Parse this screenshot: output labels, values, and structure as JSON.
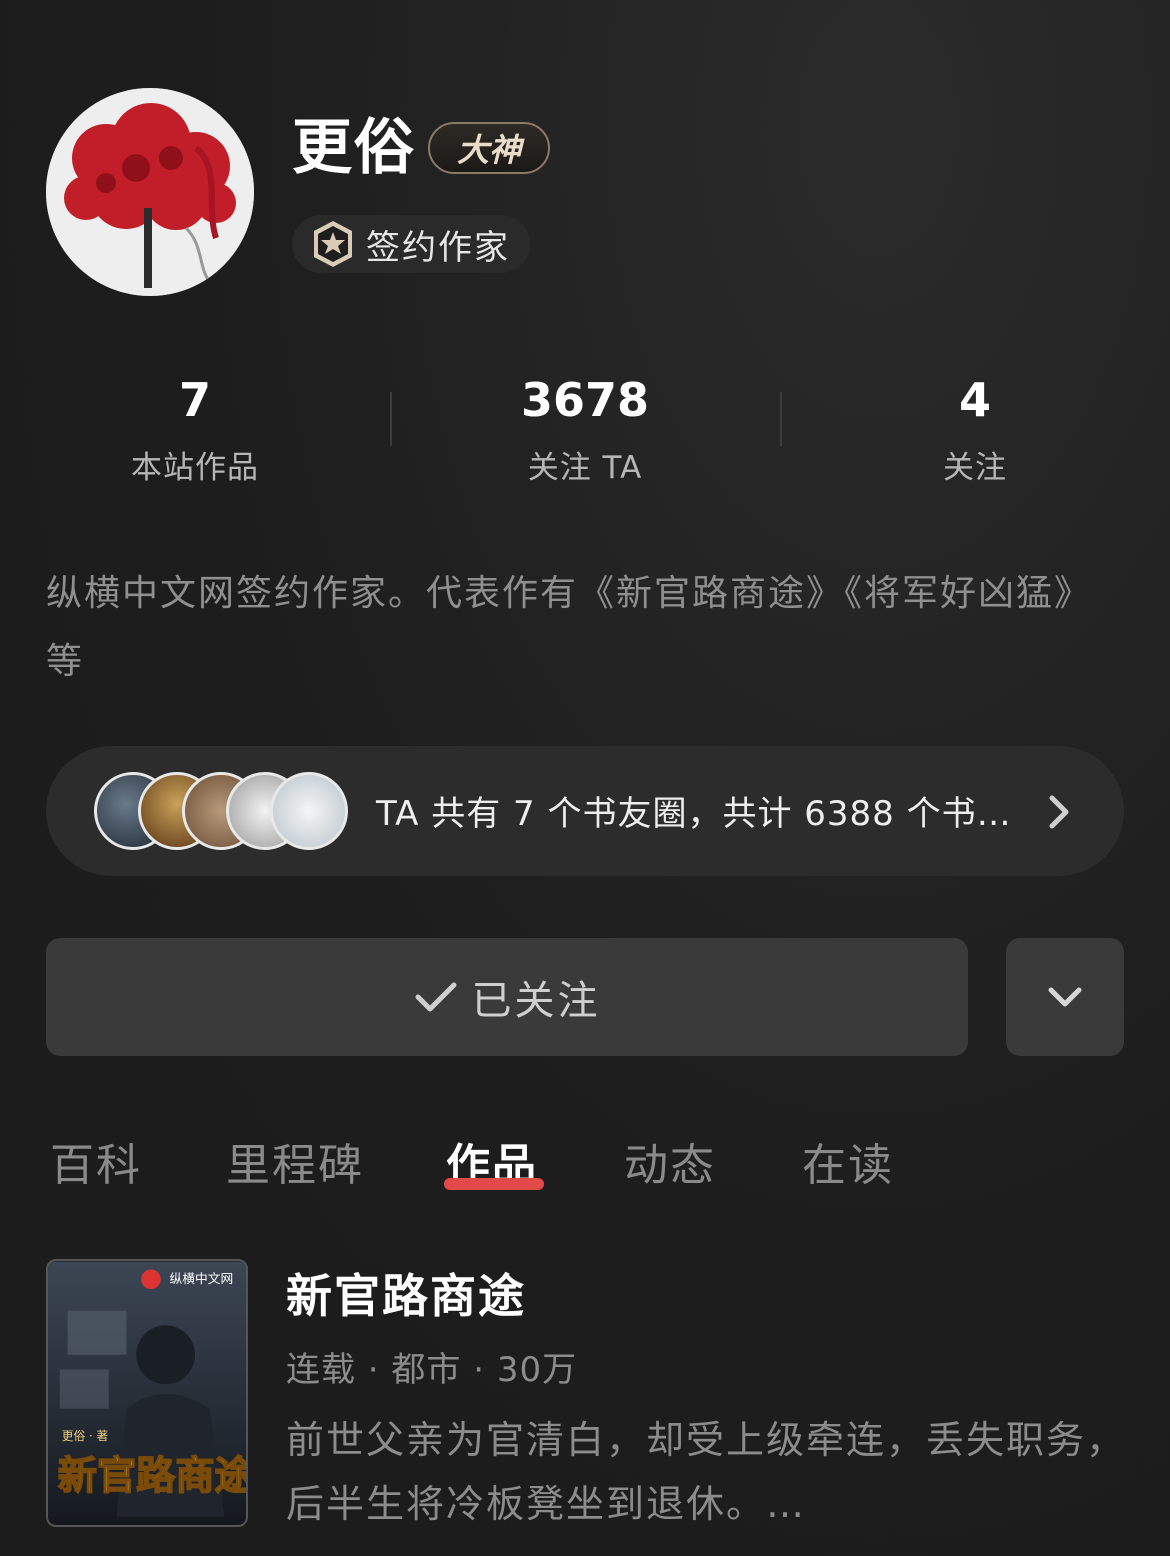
{
  "profile": {
    "name": "更俗",
    "rank_badge": "大神",
    "role": "签约作家"
  },
  "stats": [
    {
      "value": "7",
      "label": "本站作品"
    },
    {
      "value": "3678",
      "label": "关注 TA"
    },
    {
      "value": "4",
      "label": "关注"
    }
  ],
  "bio": "纵横中文网签约作家。代表作有《新官路商途》《将军好凶猛》等",
  "circles": {
    "summary": "TA 共有 7 个书友圈，共计 6388 个书…"
  },
  "actions": {
    "follow_label": "已关注"
  },
  "tabs": [
    "百科",
    "里程碑",
    "作品",
    "动态",
    "在读"
  ],
  "active_tab": "作品",
  "book": {
    "title": "新官路商途",
    "meta": "连载 · 都市 · 30万",
    "description": "前世父亲为官清白，却受上级牵连，丢失职务，后半生将冷板凳坐到退休。…",
    "cover_publisher": "纵横中文网",
    "cover_author": "更俗 · 著",
    "cover_title": "新官路商途"
  },
  "colors": {
    "background": "#1f1f1f",
    "accent": "#e24a4a",
    "muted_text": "#8c8c8c"
  }
}
